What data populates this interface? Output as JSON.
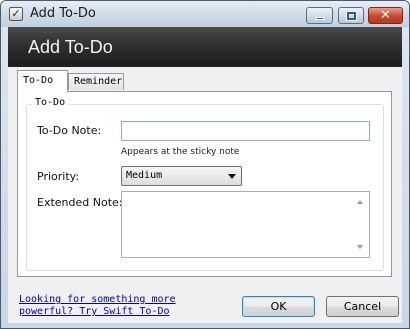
{
  "window": {
    "title": "Add To-Do",
    "controls": {
      "minimize": "minimize",
      "maximize": "maximize",
      "close": "✕"
    }
  },
  "banner": {
    "title": "Add To-Do"
  },
  "tabs": [
    {
      "label": "To-Do",
      "active": true
    },
    {
      "label": "Reminder",
      "active": false
    }
  ],
  "group": {
    "legend": "To-Do"
  },
  "form": {
    "note_label": "To-Do Note:",
    "note_value": "",
    "note_hint": "Appears at the sticky note",
    "priority_label": "Priority:",
    "priority_value": "Medium",
    "extended_label": "Extended Note:",
    "extended_value": ""
  },
  "footer": {
    "link_text": "Looking for something more powerful? Try Swift To-Do",
    "ok_label": "OK",
    "cancel_label": "Cancel"
  },
  "colors": {
    "banner_bg": "#2d2d2d",
    "link": "#0000cc",
    "close_button": "#c8452c"
  }
}
